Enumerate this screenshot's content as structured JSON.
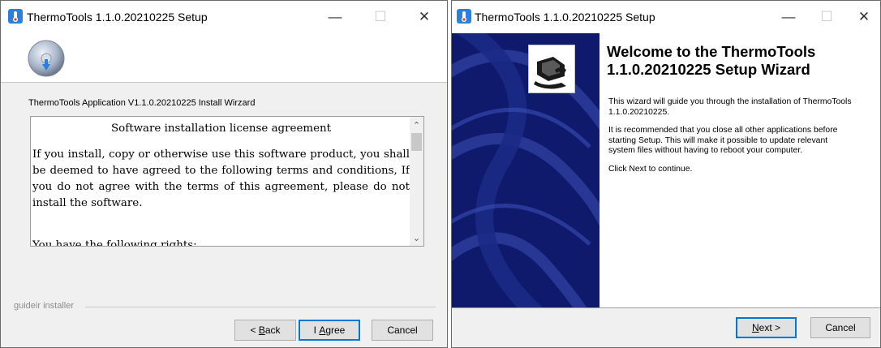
{
  "left_window": {
    "title": "ThermoTools 1.1.0.20210225 Setup",
    "wizard_caption": "ThermoTools Application V1.1.0.20210225 Install Wirzard",
    "license_heading": "Software installation license agreement",
    "license_body": "If you install, copy or otherwise use this software product, you shall be deemed to have agreed to the following terms and conditions, If you do not agree with the terms of this agreement, please do not install the software.",
    "license_cutoff": "You have the following rights:",
    "installer_label": "guideir installer",
    "buttons": {
      "back_prefix": "< ",
      "back_mnemonic": "B",
      "back_rest": "ack",
      "agree_prefix": "I ",
      "agree_mnemonic": "A",
      "agree_rest": "gree",
      "cancel": "Cancel"
    }
  },
  "right_window": {
    "title": "ThermoTools 1.1.0.20210225 Setup",
    "welcome_title": "Welcome to the ThermoTools 1.1.0.20210225 Setup Wizard",
    "welcome_paragraphs": [
      "This wizard will guide you through the installation of ThermoTools 1.1.0.20210225.",
      "It is recommended that you close all other applications before starting Setup. This will make it possible to update relevant system files without having to reboot your computer.",
      "Click Next to continue."
    ],
    "buttons": {
      "next_mnemonic": "N",
      "next_rest": "ext >",
      "cancel": "Cancel"
    }
  },
  "titlebar_icons": {
    "minimize": "—",
    "maximize": "☐",
    "close": "✕"
  },
  "colors": {
    "sidebar_blue": "#101a6c",
    "focus_blue": "#0078d7",
    "window_bg": "#f0f0f0"
  },
  "icons": [
    "installer-app-icon",
    "installer-disc-icon",
    "setup-computer-icon",
    "minimize-icon",
    "maximize-icon",
    "close-icon"
  ]
}
